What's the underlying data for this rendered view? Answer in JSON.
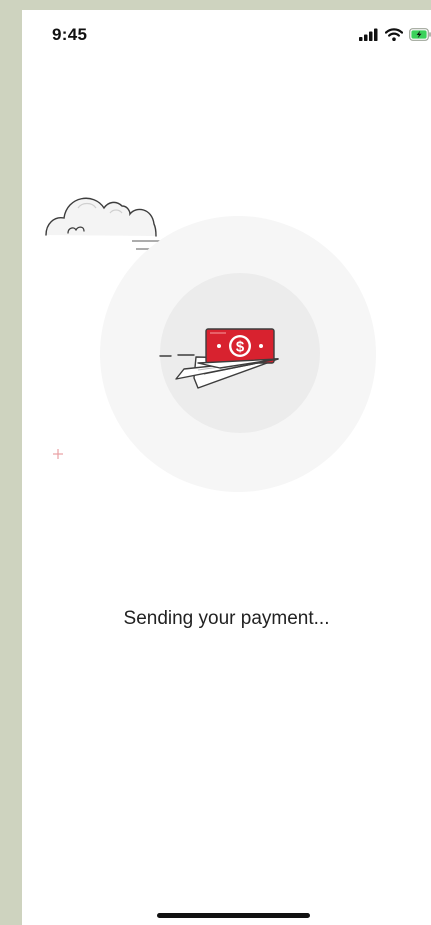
{
  "status_bar": {
    "time": "9:45",
    "icons": [
      "signal-bars-icon",
      "wifi-icon",
      "battery-charging-icon"
    ],
    "battery_color": "#3bd15a"
  },
  "illustration": {
    "icons": [
      "cloud-icon",
      "paper-plane-icon",
      "dollar-bill-icon",
      "sparkle-icon"
    ],
    "bill_color": "#d8222f",
    "bill_symbol": "$"
  },
  "message": "Sending your payment...",
  "colors": {
    "frame_background": "#ced3bf",
    "screen_background": "#ffffff",
    "outer_circle": "#f6f6f6",
    "inner_circle": "#ececec",
    "text": "#222222"
  }
}
